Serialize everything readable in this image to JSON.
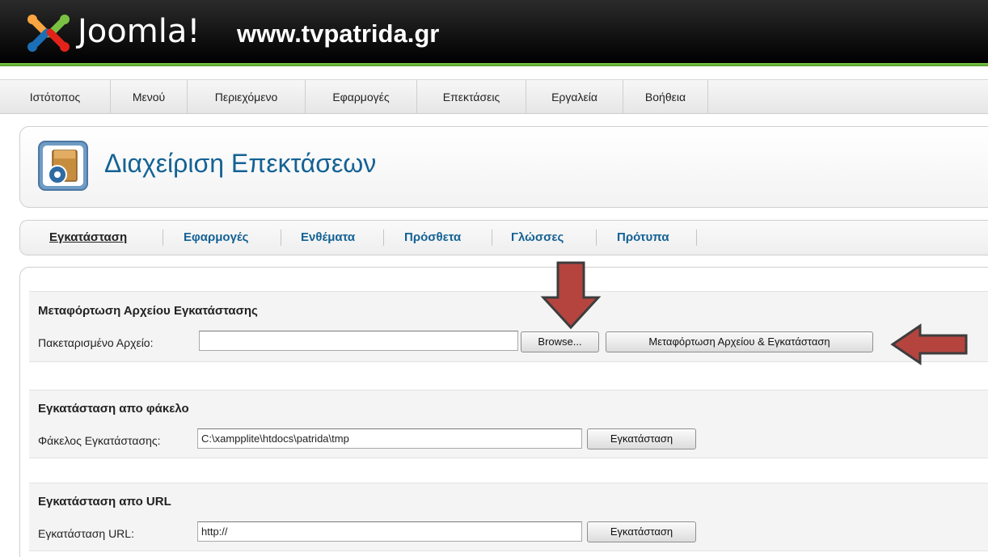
{
  "header": {
    "logo_text": "Joomla!",
    "site_name": "www.tvpatrida.gr",
    "accent_color": "#6cb33f"
  },
  "menu": {
    "items": [
      {
        "label": "Ιστότοπος"
      },
      {
        "label": "Μενού"
      },
      {
        "label": "Περιεχόμενο"
      },
      {
        "label": "Εφαρμογές"
      },
      {
        "label": "Επεκτάσεις"
      },
      {
        "label": "Εργαλεία"
      },
      {
        "label": "Βοήθεια"
      }
    ]
  },
  "page": {
    "title": "Διαχείριση Επεκτάσεων",
    "title_color": "#146295",
    "icon": "extension-manager-icon"
  },
  "tabs": {
    "items": [
      {
        "label": "Εγκατάσταση",
        "active": true
      },
      {
        "label": "Εφαρμογές",
        "active": false
      },
      {
        "label": "Ενθέματα",
        "active": false
      },
      {
        "label": "Πρόσθετα",
        "active": false
      },
      {
        "label": "Γλώσσες",
        "active": false
      },
      {
        "label": "Πρότυπα",
        "active": false
      }
    ]
  },
  "upload": {
    "title": "Μεταφόρτωση Αρχείου Εγκατάστασης",
    "label": "Πακεταρισμένο Αρχείο:",
    "value": "",
    "browse_label": "Browse...",
    "submit_label": "Μεταφόρτωση Αρχείου & Εγκατάσταση"
  },
  "folder": {
    "title": "Εγκατάσταση απο φάκελο",
    "label": "Φάκελος Εγκατάστασης:",
    "value": "C:\\xampplite\\htdocs\\patrida\\tmp",
    "submit_label": "Εγκατάσταση"
  },
  "url": {
    "title": "Εγκατάσταση απο URL",
    "label": "Εγκατάσταση URL:",
    "value": "http://",
    "submit_label": "Εγκατάσταση"
  },
  "annotations": {
    "arrow_color": "#b5443f",
    "arrow_icons": [
      "down-arrow-icon",
      "left-arrow-icon"
    ]
  }
}
